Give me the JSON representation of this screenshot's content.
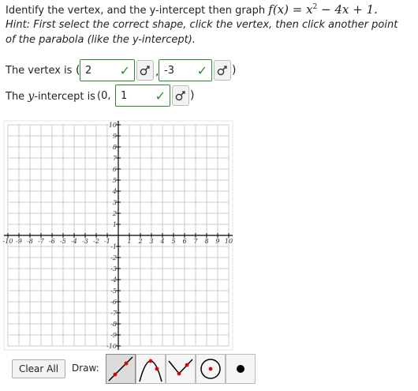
{
  "question": {
    "prefix": "Identify the vertex, and the y-intercept then graph",
    "fx": "f(x)",
    "equals": "=",
    "poly_x": "x",
    "poly_exp": "2",
    "poly_rest": "− 4x + 1.",
    "hint": "Hint: First select the correct shape, click the vertex, then click another point of the parabola (like the y-intercept)."
  },
  "vertex_row": {
    "label": "The vertex is",
    "open": "(",
    "comma": ",",
    "close": ")",
    "x_value": "2",
    "y_value": "-3"
  },
  "yint_row": {
    "label_pre": "The",
    "label_var": "y",
    "label_post": "-intercept is",
    "open": "(0,",
    "value": "1",
    "close": ")"
  },
  "graph": {
    "x_min": -10,
    "x_max": 10,
    "y_min": -10,
    "y_max": 10,
    "grid": true,
    "x_ticks": [
      "-10",
      "-9",
      "-8",
      "-7",
      "-6",
      "-5",
      "-4",
      "-3",
      "-2",
      "-1",
      "1",
      "2",
      "3",
      "4",
      "5",
      "6",
      "7",
      "8",
      "9",
      "10"
    ],
    "y_ticks": [
      "10",
      "9",
      "8",
      "7",
      "6",
      "5",
      "4",
      "3",
      "2",
      "1",
      "-1",
      "-2",
      "-3",
      "-4",
      "-5",
      "-6",
      "-7",
      "-8",
      "-9",
      "-10"
    ]
  },
  "toolbar": {
    "clear_label": "Clear All",
    "draw_label": "Draw:",
    "tools": [
      "line-tool-icon",
      "parabola-tool-icon",
      "absolute-value-tool-icon",
      "circle-tool-icon",
      "point-tool-icon"
    ],
    "active_tool": "line-tool-icon"
  },
  "colors": {
    "check": "#2e8b2e",
    "accent_red": "#e00000",
    "grid": "#cccccc"
  }
}
